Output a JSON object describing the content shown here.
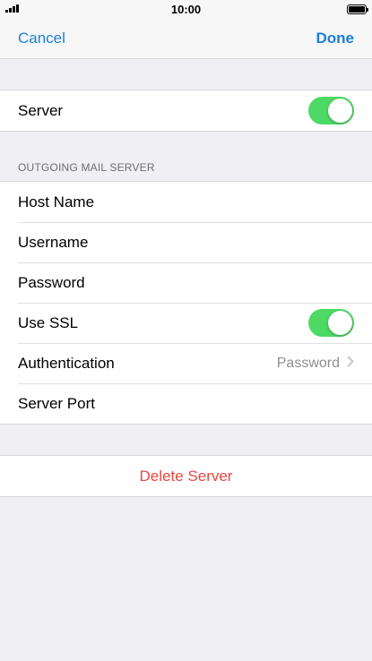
{
  "status_bar": {
    "time": "10:00",
    "battery_icon": "battery-icon",
    "signal_icon": "signal-icon"
  },
  "nav": {
    "cancel_label": "Cancel",
    "done_label": "Done",
    "accent_color": "#1a7fd8"
  },
  "server": {
    "label": "Server",
    "enabled": true
  },
  "outgoing": {
    "header": "OUTGOING MAIL SERVER",
    "host_name_label": "Host Name",
    "username_label": "Username",
    "password_label": "Password",
    "use_ssl_label": "Use SSL",
    "use_ssl_enabled": true,
    "authentication_label": "Authentication",
    "authentication_value": "Password",
    "server_port_label": "Server Port"
  },
  "delete": {
    "label": "Delete Server",
    "color": "#e5473f"
  },
  "toggle_on_color": "#4cd964"
}
